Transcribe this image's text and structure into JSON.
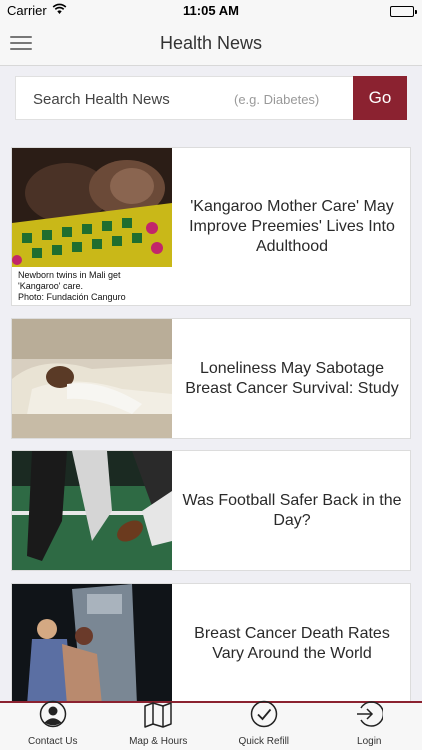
{
  "status_bar": {
    "carrier": "Carrier",
    "time": "11:05 AM"
  },
  "nav": {
    "title": "Health News",
    "menu_icon": "hamburger-menu-icon"
  },
  "search": {
    "label": "Search Health News",
    "hint": "(e.g. Diabetes)",
    "button": "Go"
  },
  "articles": [
    {
      "headline": "'Kangaroo Mother Care' May Improve Preemies' Lives Into Adulthood",
      "caption_line1": "Newborn twins in Mali get",
      "caption_line2": "'Kangaroo' care.",
      "caption_line3": "Photo: Fundación Canguro"
    },
    {
      "headline": "Loneliness May Sabotage Breast Cancer Survival: Study"
    },
    {
      "headline": "Was Football Safer Back in the Day?"
    },
    {
      "headline": "Breast Cancer Death Rates Vary Around the World"
    }
  ],
  "tabs": [
    {
      "label": "Contact Us",
      "icon": "person-icon"
    },
    {
      "label": "Map & Hours",
      "icon": "map-icon"
    },
    {
      "label": "Quick Refill",
      "icon": "checkmark-circle-icon"
    },
    {
      "label": "Login",
      "icon": "login-icon"
    }
  ],
  "colors": {
    "accent": "#8b2230",
    "background": "#efeff4"
  }
}
